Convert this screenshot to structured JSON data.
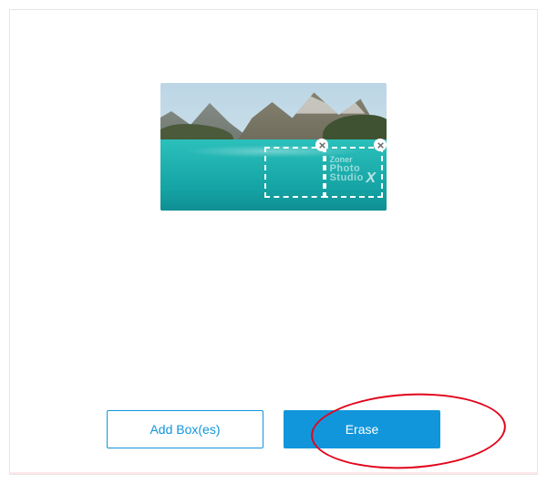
{
  "canvas": {
    "watermark_line1": "Zoner",
    "watermark_line2": "Photo",
    "watermark_line3": "Studio",
    "watermark_suffix": "X",
    "selection_boxes": [
      {
        "id": "A"
      },
      {
        "id": "B"
      }
    ]
  },
  "toolbar": {
    "add_box_label": "Add Box(es)",
    "erase_label": "Erase"
  },
  "colors": {
    "accent": "#1296db",
    "highlight": "#e2041b"
  }
}
